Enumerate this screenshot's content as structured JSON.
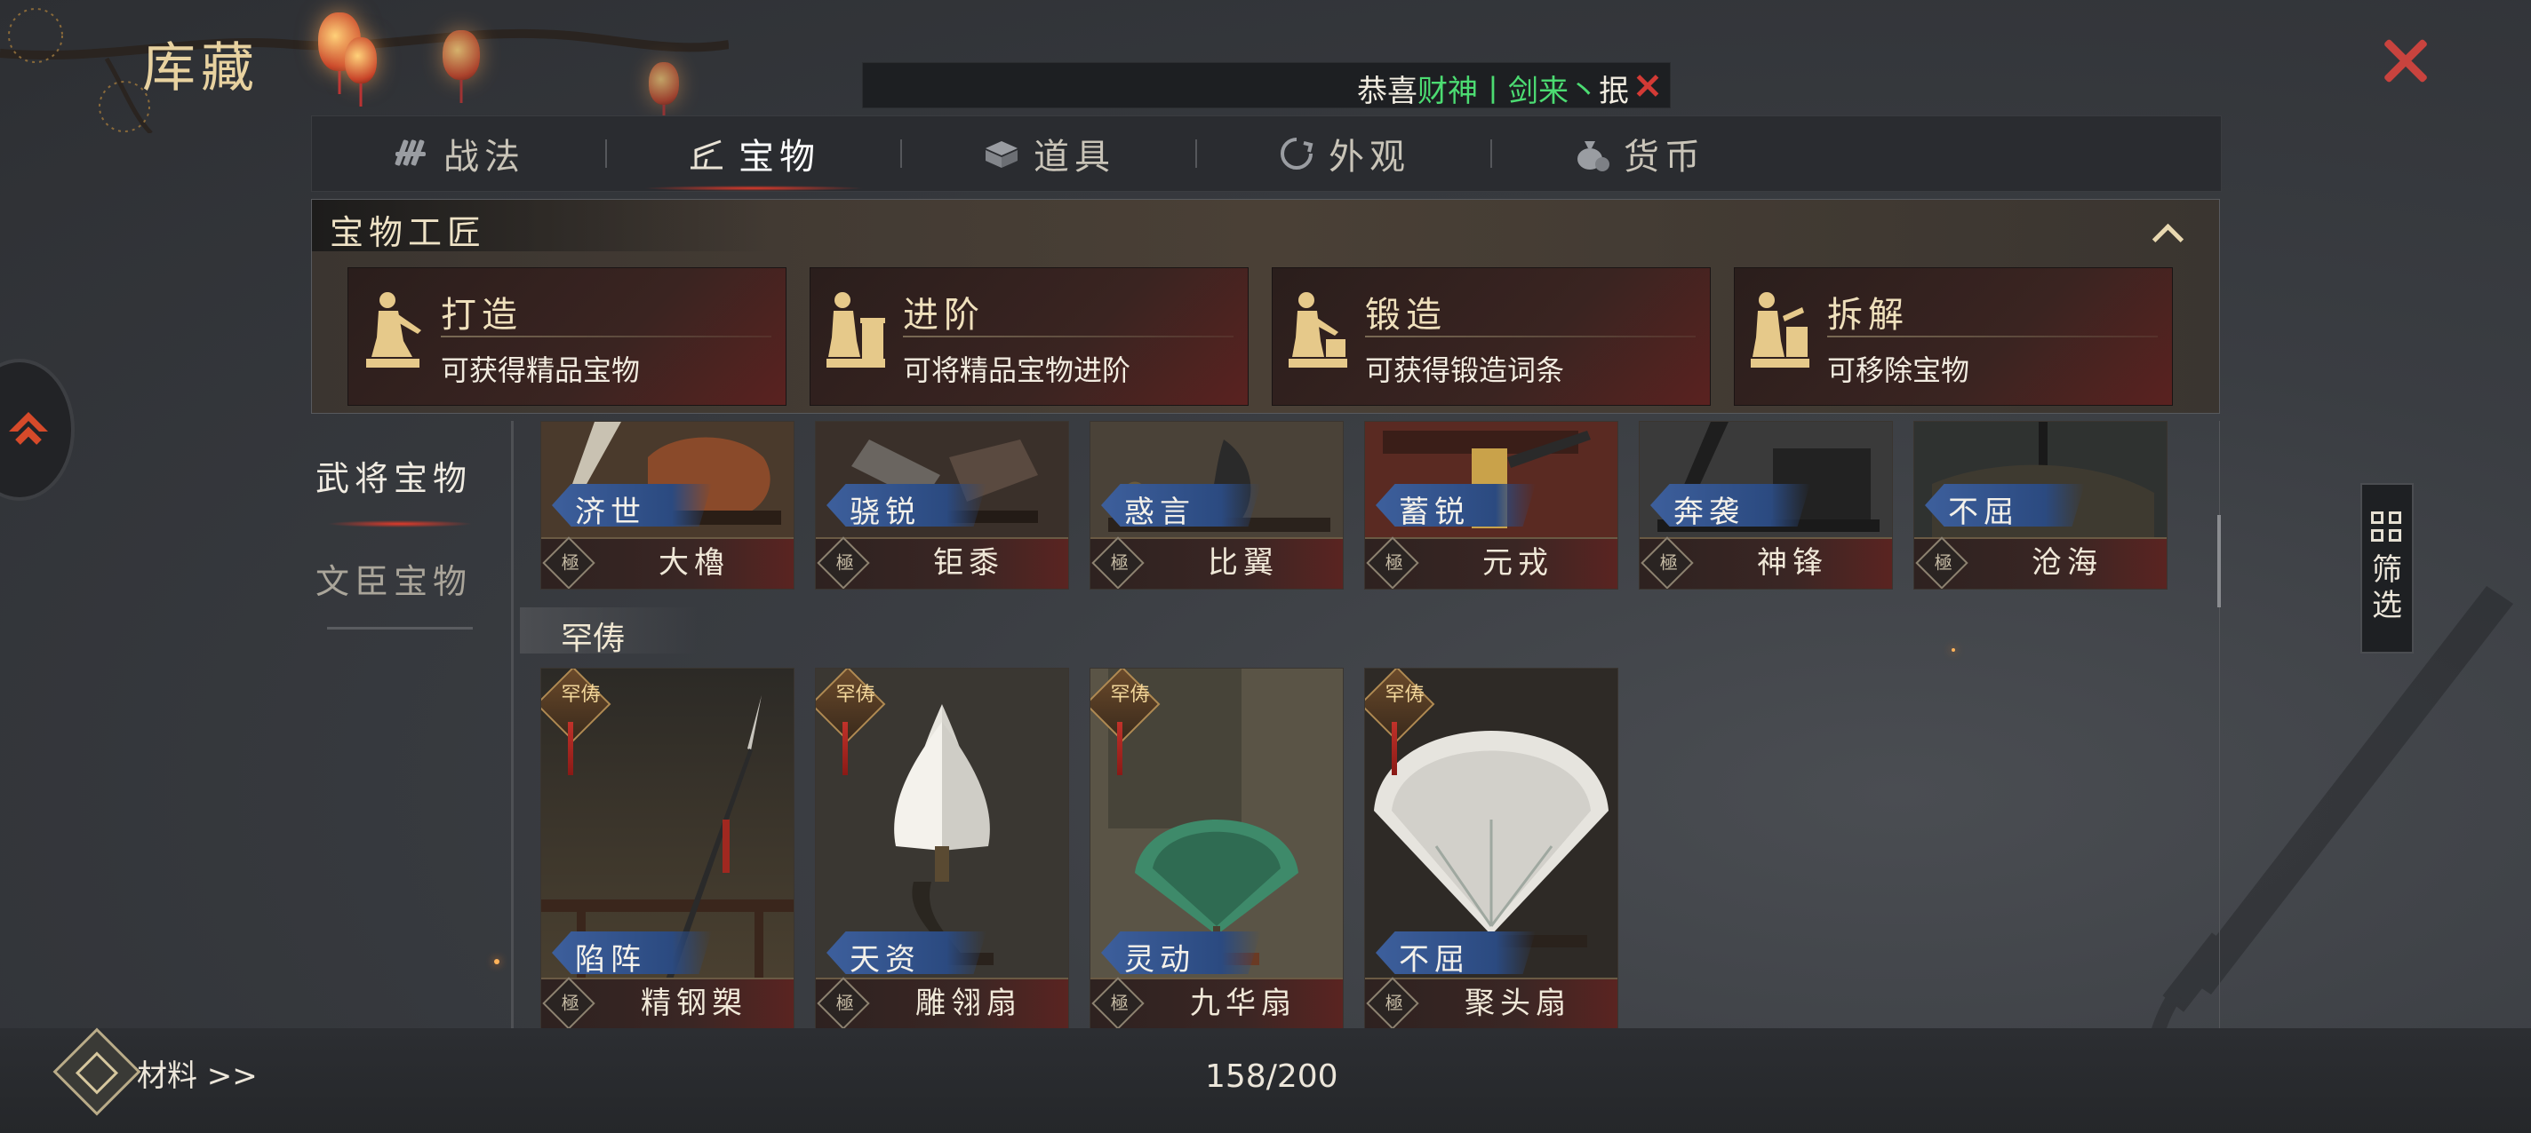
{
  "page": {
    "title": "库藏"
  },
  "marquee": {
    "prefix": "恭喜",
    "highlight": "财神丨剑来丶",
    "suffix": "抿"
  },
  "tabs": [
    {
      "label": "战法",
      "icon": "scroll-bundle-icon",
      "active": false
    },
    {
      "label": "宝物",
      "icon": "treasure-rack-icon",
      "active": true
    },
    {
      "label": "道具",
      "icon": "item-box-icon",
      "active": false
    },
    {
      "label": "外观",
      "icon": "appearance-swirl-icon",
      "active": false
    },
    {
      "label": "货币",
      "icon": "money-bag-icon",
      "active": false
    }
  ],
  "craftsman": {
    "title": "宝物工匠",
    "cards": [
      {
        "name": "打造",
        "desc": "可获得精品宝物",
        "icon": "smith-figure-icon"
      },
      {
        "name": "进阶",
        "desc": "可将精品宝物进阶",
        "icon": "smith-figure-icon"
      },
      {
        "name": "锻造",
        "desc": "可获得锻造词条",
        "icon": "smith-figure-icon"
      },
      {
        "name": "拆解",
        "desc": "可移除宝物",
        "icon": "smith-figure-icon"
      }
    ]
  },
  "categories": [
    {
      "label": "武将宝物",
      "active": true
    },
    {
      "label": "文臣宝物",
      "active": false
    }
  ],
  "top_items": [
    {
      "trait": "济世",
      "grade": "極",
      "name": "大櫓"
    },
    {
      "trait": "骁锐",
      "grade": "極",
      "name": "钜黍"
    },
    {
      "trait": "惑言",
      "grade": "極",
      "name": "比翼"
    },
    {
      "trait": "蓄锐",
      "grade": "極",
      "name": "元戎"
    },
    {
      "trait": "奔袭",
      "grade": "極",
      "name": "神锋"
    },
    {
      "trait": "不屈",
      "grade": "極",
      "name": "沧海"
    }
  ],
  "section": {
    "label": "罕俦"
  },
  "rare_items": [
    {
      "badge": "罕俦",
      "trait": "陷阵",
      "grade": "極",
      "name": "精钢槊"
    },
    {
      "badge": "罕俦",
      "trait": "天资",
      "grade": "極",
      "name": "雕翎扇"
    },
    {
      "badge": "罕俦",
      "trait": "灵动",
      "grade": "極",
      "name": "九华扇"
    },
    {
      "badge": "罕俦",
      "trait": "不屈",
      "grade": "極",
      "name": "聚头扇"
    }
  ],
  "filter": {
    "label": "筛选"
  },
  "bottom": {
    "materials": "材料 >>",
    "count": "158/200"
  }
}
